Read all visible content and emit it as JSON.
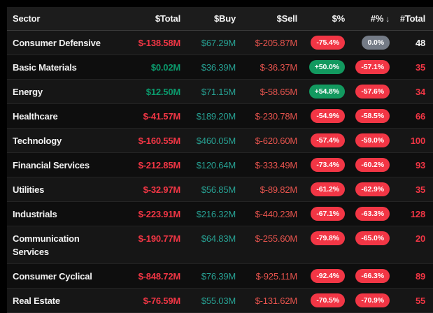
{
  "colors": {
    "red": "#f23645",
    "red_soft": "#e8544e",
    "green": "#0b9b6d",
    "green_soft": "#27a193",
    "badge_red": "#f23645",
    "badge_green": "#12995f",
    "badge_gray": "#747b86",
    "header_bg": "#1c1c1c",
    "row_odd": "#161616",
    "row_even": "#0e0e0e"
  },
  "table": {
    "columns": [
      {
        "key": "sector",
        "label": "Sector",
        "align": "left"
      },
      {
        "key": "total",
        "label": "$Total",
        "align": "right"
      },
      {
        "key": "buy",
        "label": "$Buy",
        "align": "right"
      },
      {
        "key": "sell",
        "label": "$Sell",
        "align": "right"
      },
      {
        "key": "pct_value",
        "label": "$%",
        "align": "right"
      },
      {
        "key": "pct_count",
        "label": "#%",
        "align": "right",
        "sorted": "desc",
        "sort_indicator": "↓"
      },
      {
        "key": "count_total",
        "label": "#Total",
        "align": "right"
      }
    ],
    "rows": [
      {
        "sector": "Consumer Defensive",
        "total": "$-138.58M",
        "total_tone": "neg",
        "buy": "$67.29M",
        "buy_tone": "pos-soft",
        "sell": "$-205.87M",
        "sell_tone": "neg-soft",
        "pct_value": "-75.4%",
        "pct_value_tone": "neg",
        "pct_count": "0.0%",
        "pct_count_tone": "neutral",
        "count_total": "48",
        "count_total_tone": "plain"
      },
      {
        "sector": "Basic Materials",
        "total": "$0.02M",
        "total_tone": "pos",
        "buy": "$36.39M",
        "buy_tone": "pos-soft",
        "sell": "$-36.37M",
        "sell_tone": "neg-soft",
        "pct_value": "+50.0%",
        "pct_value_tone": "pos",
        "pct_count": "-57.1%",
        "pct_count_tone": "neg",
        "count_total": "35",
        "count_total_tone": "neg"
      },
      {
        "sector": "Energy",
        "total": "$12.50M",
        "total_tone": "pos",
        "buy": "$71.15M",
        "buy_tone": "pos-soft",
        "sell": "$-58.65M",
        "sell_tone": "neg-soft",
        "pct_value": "+54.8%",
        "pct_value_tone": "pos",
        "pct_count": "-57.6%",
        "pct_count_tone": "neg",
        "count_total": "34",
        "count_total_tone": "neg"
      },
      {
        "sector": "Healthcare",
        "total": "$-41.57M",
        "total_tone": "neg",
        "buy": "$189.20M",
        "buy_tone": "pos-soft",
        "sell": "$-230.78M",
        "sell_tone": "neg-soft",
        "pct_value": "-54.9%",
        "pct_value_tone": "neg",
        "pct_count": "-58.5%",
        "pct_count_tone": "neg",
        "count_total": "66",
        "count_total_tone": "neg"
      },
      {
        "sector": "Technology",
        "total": "$-160.55M",
        "total_tone": "neg",
        "buy": "$460.05M",
        "buy_tone": "pos-soft",
        "sell": "$-620.60M",
        "sell_tone": "neg-soft",
        "pct_value": "-57.4%",
        "pct_value_tone": "neg",
        "pct_count": "-59.0%",
        "pct_count_tone": "neg",
        "count_total": "100",
        "count_total_tone": "neg"
      },
      {
        "sector": "Financial Services",
        "total": "$-212.85M",
        "total_tone": "neg",
        "buy": "$120.64M",
        "buy_tone": "pos-soft",
        "sell": "$-333.49M",
        "sell_tone": "neg-soft",
        "pct_value": "-73.4%",
        "pct_value_tone": "neg",
        "pct_count": "-60.2%",
        "pct_count_tone": "neg",
        "count_total": "93",
        "count_total_tone": "neg"
      },
      {
        "sector": "Utilities",
        "total": "$-32.97M",
        "total_tone": "neg",
        "buy": "$56.85M",
        "buy_tone": "pos-soft",
        "sell": "$-89.82M",
        "sell_tone": "neg-soft",
        "pct_value": "-61.2%",
        "pct_value_tone": "neg",
        "pct_count": "-62.9%",
        "pct_count_tone": "neg",
        "count_total": "35",
        "count_total_tone": "neg"
      },
      {
        "sector": "Industrials",
        "total": "$-223.91M",
        "total_tone": "neg",
        "buy": "$216.32M",
        "buy_tone": "pos-soft",
        "sell": "$-440.23M",
        "sell_tone": "neg-soft",
        "pct_value": "-67.1%",
        "pct_value_tone": "neg",
        "pct_count": "-63.3%",
        "pct_count_tone": "neg",
        "count_total": "128",
        "count_total_tone": "neg"
      },
      {
        "sector": "Communication Services",
        "total": "$-190.77M",
        "total_tone": "neg",
        "buy": "$64.83M",
        "buy_tone": "pos-soft",
        "sell": "$-255.60M",
        "sell_tone": "neg-soft",
        "pct_value": "-79.8%",
        "pct_value_tone": "neg",
        "pct_count": "-65.0%",
        "pct_count_tone": "neg",
        "count_total": "20",
        "count_total_tone": "neg"
      },
      {
        "sector": "Consumer Cyclical",
        "total": "$-848.72M",
        "total_tone": "neg",
        "buy": "$76.39M",
        "buy_tone": "pos-soft",
        "sell": "$-925.11M",
        "sell_tone": "neg-soft",
        "pct_value": "-92.4%",
        "pct_value_tone": "neg",
        "pct_count": "-66.3%",
        "pct_count_tone": "neg",
        "count_total": "89",
        "count_total_tone": "neg"
      },
      {
        "sector": "Real Estate",
        "total": "$-76.59M",
        "total_tone": "neg",
        "buy": "$55.03M",
        "buy_tone": "pos-soft",
        "sell": "$-131.62M",
        "sell_tone": "neg-soft",
        "pct_value": "-70.5%",
        "pct_value_tone": "neg",
        "pct_count": "-70.9%",
        "pct_count_tone": "neg",
        "count_total": "55",
        "count_total_tone": "neg"
      }
    ]
  }
}
